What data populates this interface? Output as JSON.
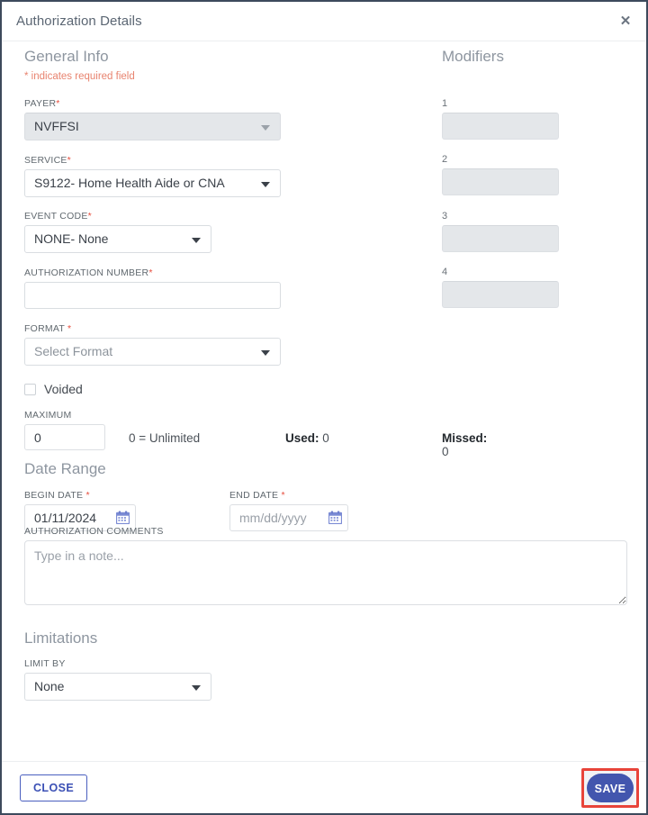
{
  "window": {
    "title": "Authorization Details",
    "close_icon": "close-icon"
  },
  "required_note": "* indicates required field",
  "sections": {
    "general_info": "General Info",
    "modifiers": "Modifiers",
    "date_range": "Date Range",
    "limitations": "Limitations"
  },
  "fields": {
    "payer": {
      "label": "PAYER",
      "required": "*",
      "value": "NVFFSI",
      "disabled": true
    },
    "service": {
      "label": "SERVICE",
      "required": "*",
      "value": "S9122- Home Health Aide or CNA",
      "disabled": false
    },
    "event_code": {
      "label": "EVENT CODE",
      "required": "*",
      "value": "NONE- None",
      "disabled": false
    },
    "authorization_number": {
      "label": "AUTHORIZATION NUMBER",
      "required": "*",
      "value": "",
      "placeholder": ""
    },
    "format": {
      "label": "FORMAT ",
      "required": "*",
      "value": "Select Format",
      "is_placeholder": true
    },
    "voided": {
      "label": "Voided",
      "checked": false
    },
    "maximum": {
      "label": "MAXIMUM",
      "value": "0",
      "hint": "0 = Unlimited"
    },
    "used": {
      "label": "Used:",
      "value": "0"
    },
    "missed": {
      "label": "Missed:",
      "value": "0"
    },
    "begin_date": {
      "label": "BEGIN DATE ",
      "required": "*",
      "value": "01/11/2024",
      "icon": "calendar-icon"
    },
    "end_date": {
      "label": "END DATE ",
      "required": "*",
      "value": "",
      "placeholder": "mm/dd/yyyy",
      "icon": "calendar-icon"
    },
    "authorization_comments": {
      "label": "AUTHORIZATION COMMENTS",
      "value": "",
      "placeholder": "Type in a note..."
    },
    "limit_by": {
      "label": "LIMIT BY",
      "value": "None"
    }
  },
  "modifiers": [
    {
      "num": "1",
      "value": "",
      "disabled": true
    },
    {
      "num": "2",
      "value": "",
      "disabled": true
    },
    {
      "num": "3",
      "value": "",
      "disabled": true
    },
    {
      "num": "4",
      "value": "",
      "disabled": true
    }
  ],
  "footer": {
    "close_label": "CLOSE",
    "save_label": "SAVE"
  },
  "colors": {
    "accent_blue": "#4356ae",
    "required_red": "#e74c3c",
    "note_orange": "#e8836f",
    "highlight_red": "#e8443a",
    "calendar_blue": "#7b8bd4",
    "disabled_grey": "#e4e7ea"
  }
}
